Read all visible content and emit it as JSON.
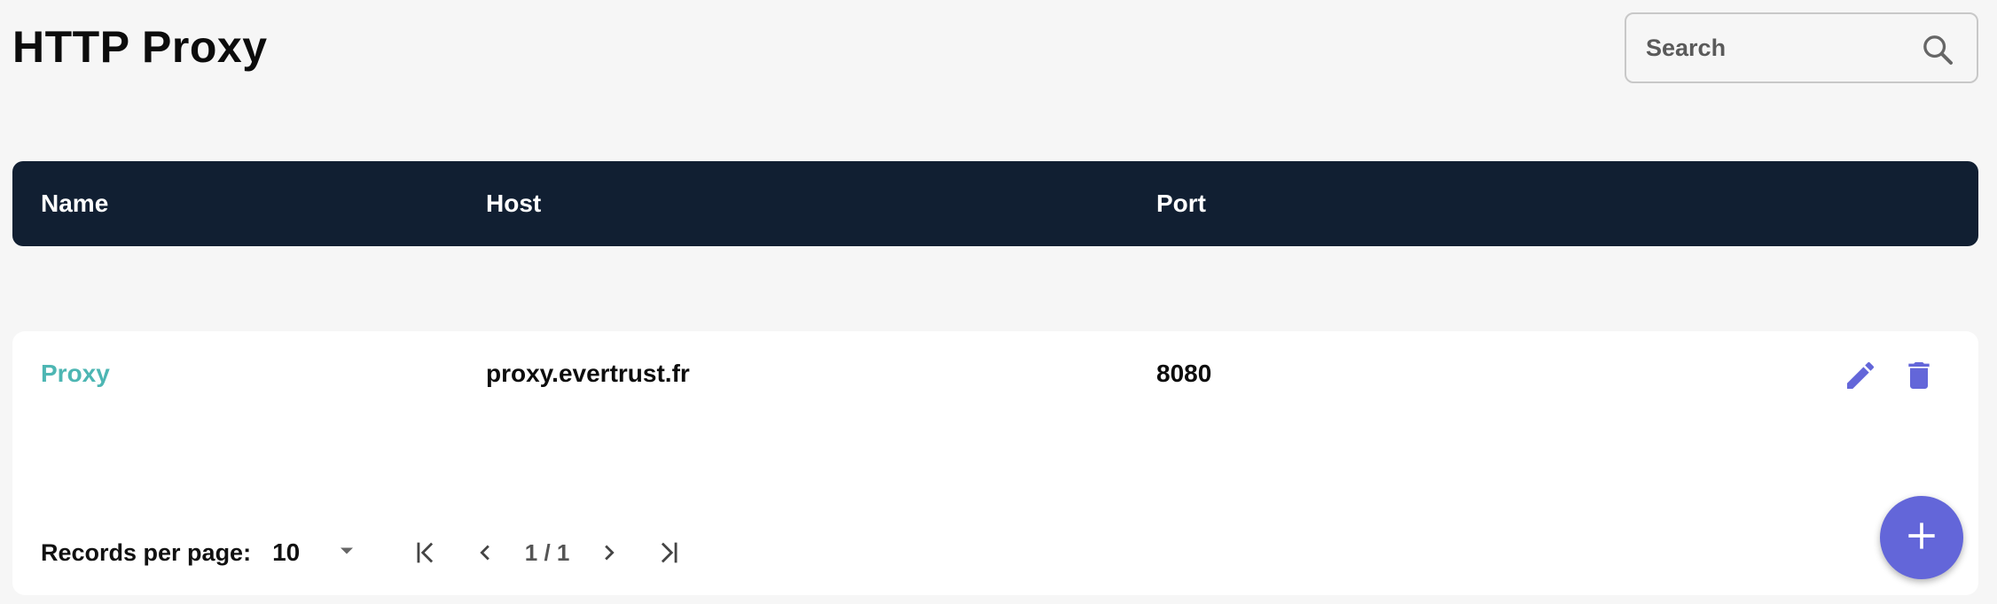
{
  "page": {
    "title": "HTTP Proxy"
  },
  "search": {
    "placeholder": "Search",
    "icon": "search-icon"
  },
  "table": {
    "columns": [
      "Name",
      "Host",
      "Port"
    ],
    "rows": [
      {
        "name": "Proxy",
        "host": "proxy.evertrust.fr",
        "port": "8080"
      }
    ],
    "row_actions": [
      "edit-icon",
      "delete-icon"
    ]
  },
  "pagination": {
    "records_label": "Records per page:",
    "page_size": "10",
    "page_info": "1 / 1"
  },
  "fab": {
    "icon": "plus-icon"
  },
  "colors": {
    "header_bg": "#111f32",
    "accent": "#6366d9",
    "link": "#4db6b3",
    "page_bg": "#f6f6f6"
  }
}
